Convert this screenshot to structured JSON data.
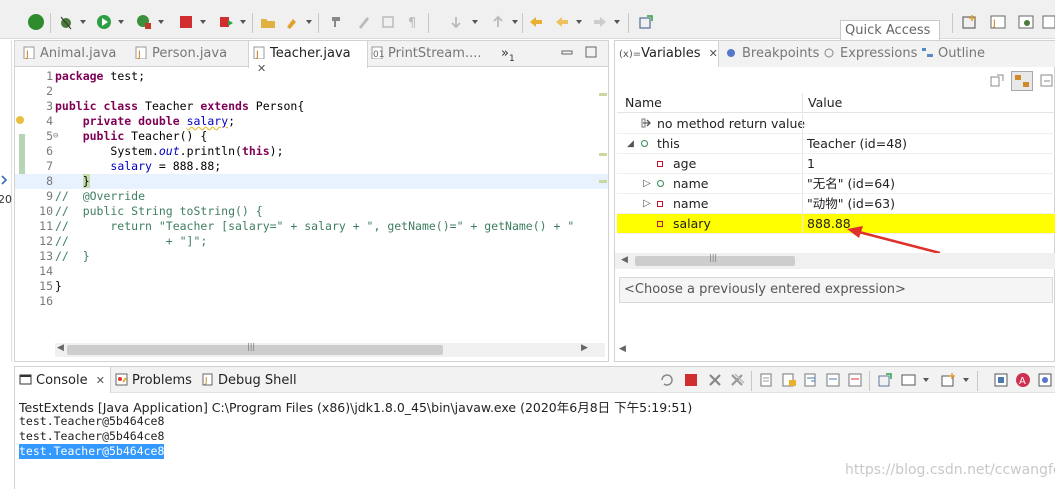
{
  "toolbar": {
    "quick_access_placeholder": "Quick Access"
  },
  "editor": {
    "tabs": [
      {
        "label": "Animal.java"
      },
      {
        "label": "Person.java"
      },
      {
        "label": "Teacher.java",
        "close": "✕"
      },
      {
        "label": "PrintStream...."
      }
    ],
    "overflow_label": "»",
    "overflow_count": "1",
    "lines": [
      {
        "num": "1"
      },
      {
        "num": "2"
      },
      {
        "num": "3"
      },
      {
        "num": "4"
      },
      {
        "num": "5"
      },
      {
        "num": "6"
      },
      {
        "num": "7"
      },
      {
        "num": "8"
      },
      {
        "num": "9"
      },
      {
        "num": "10"
      },
      {
        "num": "11"
      },
      {
        "num": "12"
      },
      {
        "num": "13"
      },
      {
        "num": "14"
      },
      {
        "num": "15"
      },
      {
        "num": "16"
      }
    ],
    "code": {
      "l1_kw": "package",
      "l1_rest": " test;",
      "l3_kw1": "public class",
      "l3_mid": " Teacher ",
      "l3_kw2": "extends",
      "l3_rest": " Person{",
      "l4_kw": "private double",
      "l4_fld": "salary",
      "l4_rest": ";",
      "l5_kw": "public",
      "l5_rest": " Teacher() {",
      "l6_a": "System.",
      "l6_st": "out",
      "l6_b": ".println(",
      "l6_kw": "this",
      "l6_c": ");",
      "l7_fld": "salary",
      "l7_rest": " = 888.88;",
      "l8": "}",
      "l9": "//  @Override",
      "l10": "//  public String toString() {",
      "l11": "//      return \"Teacher [salary=\" + salary + \", getName()=\" + getName() + \"",
      "l12": "//              + \"]\";",
      "l13": "//  }",
      "l15": "}"
    }
  },
  "variables": {
    "tabs": [
      {
        "label": "Variables",
        "prefix": "(x)=",
        "close": "✕"
      },
      {
        "label": "Breakpoints"
      },
      {
        "label": "Expressions"
      },
      {
        "label": "Outline"
      }
    ],
    "col_name": "Name",
    "col_value": "Value",
    "rows": [
      {
        "name": "no method return value",
        "value": ""
      },
      {
        "name": "this",
        "value": "Teacher  (id=48)"
      },
      {
        "name": "age",
        "value": "1"
      },
      {
        "name": "name",
        "value": "\"无名\" (id=64)"
      },
      {
        "name": "name",
        "value": "\"动物\" (id=63)"
      },
      {
        "name": "salary",
        "value": "888.88"
      }
    ],
    "scroll_grip": "|||",
    "expression_placeholder": "<Choose a previously entered expression>"
  },
  "console": {
    "tabs": [
      {
        "label": "Console",
        "close": "✕"
      },
      {
        "label": "Problems"
      },
      {
        "label": "Debug Shell"
      }
    ],
    "launch_info": "TestExtends [Java Application] C:\\Program Files (x86)\\jdk1.8.0_45\\bin\\javaw.exe (2020年6月8日 下午5:19:51)",
    "output": [
      "test.Teacher@5b464ce8",
      "test.Teacher@5b464ce8",
      "test.Teacher@5b464ce8"
    ],
    "watermark": "https://blog.csdn.net/ccwangfei"
  },
  "colors": {
    "highlight_row": "#ffff00",
    "selection": "#3399ff",
    "arrow": "#e0302a",
    "keyword": "#7f0055",
    "field": "#0000c0",
    "comment": "#3f7f5f"
  }
}
